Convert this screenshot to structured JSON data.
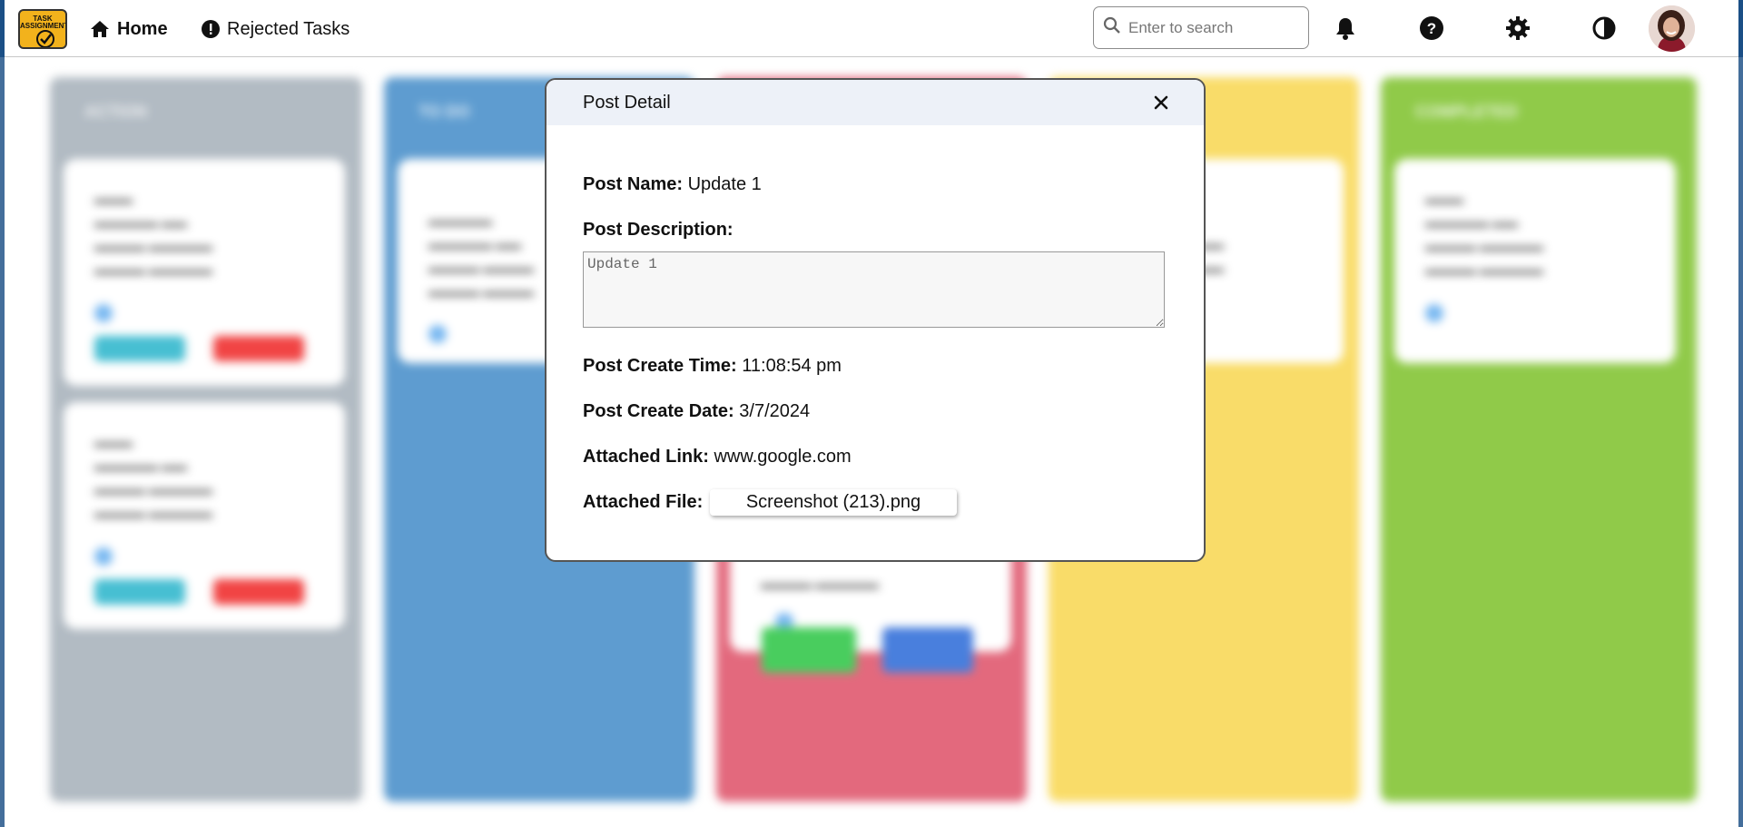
{
  "app": {
    "logo_text": "TASK ASSIGNMENT"
  },
  "nav": {
    "home_label": "Home",
    "rejected_label": "Rejected Tasks"
  },
  "search": {
    "placeholder": "Enter to search"
  },
  "board": {
    "columns": [
      {
        "title": "ACTION",
        "color": "#a1acb6"
      },
      {
        "title": "TO DO",
        "color": "#3b87c6"
      },
      {
        "title": "",
        "color": "#dd4961"
      },
      {
        "title": "",
        "color": "#f8d548"
      },
      {
        "title": "COMPLETED",
        "color": "#78bf22"
      }
    ]
  },
  "modal": {
    "title": "Post Detail",
    "post_name_label": "Post Name:",
    "post_name": "Update 1",
    "post_description_label": "Post Description:",
    "post_description": "Update 1",
    "create_time_label": "Post Create Time:",
    "create_time": "11:08:54 pm",
    "create_date_label": "Post Create Date:",
    "create_date": "3/7/2024",
    "link_label": "Attached Link:",
    "link": "www.google.com",
    "file_label": "Attached File:",
    "file": "Screenshot (213).png"
  },
  "icons": {
    "home": "home-icon",
    "rejected": "exclamation-circle-icon",
    "search": "search-icon",
    "bell": "bell-icon",
    "help": "question-circle-icon",
    "settings": "gear-icon",
    "theme": "contrast-icon",
    "close": "close-icon"
  }
}
